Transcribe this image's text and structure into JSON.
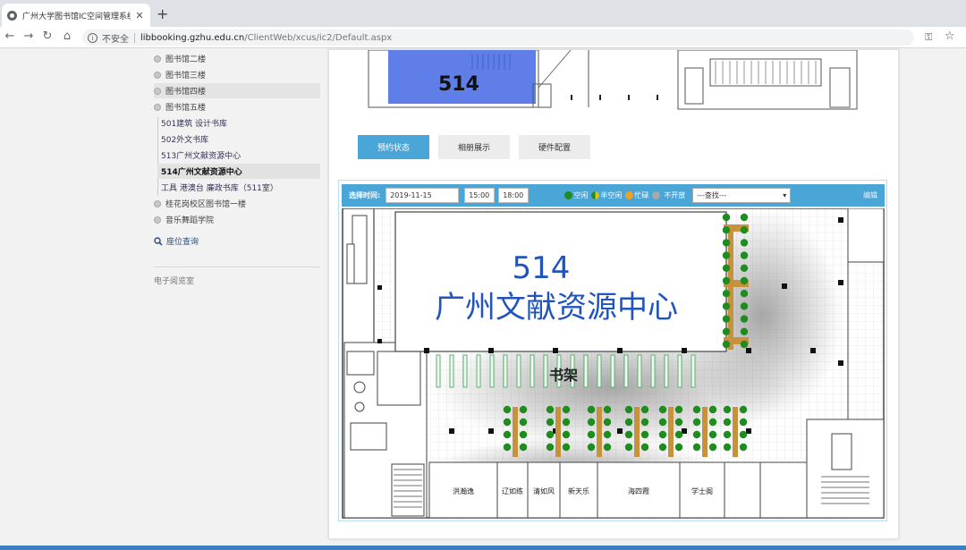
{
  "browser": {
    "tab_title": "广州大学图书馆IC空间管理系统",
    "tab_close": "✕",
    "new_tab": "+",
    "insecure_label": "不安全",
    "url_host": "libbooking.gzhu.edu.cn",
    "url_path": "/ClientWeb/xcus/ic2/Default.aspx",
    "nav": {
      "back": "←",
      "forward": "→",
      "reload": "↻",
      "home": "⌂"
    },
    "key_icon": "⚿",
    "star_icon": "☆"
  },
  "sidebar": {
    "items": [
      {
        "label": "图书馆二楼"
      },
      {
        "label": "图书馆三楼"
      },
      {
        "label": "图书馆四楼"
      },
      {
        "label": "图书馆五楼"
      }
    ],
    "sub_items": [
      {
        "label": "501建筑 设计书库"
      },
      {
        "label": "502外文书库"
      },
      {
        "label": "513广州文献资源中心"
      },
      {
        "label": "514广州文献资源中心"
      },
      {
        "label": "工具 港澳台 廉政书库（511室）"
      }
    ],
    "more_items": [
      {
        "label": "桂花岗校区图书馆一楼"
      },
      {
        "label": "音乐舞蹈学院"
      }
    ],
    "search": "座位查询",
    "ebook": "电子阅览室"
  },
  "content": {
    "top_plan_label": "514",
    "tabs": [
      {
        "label": "预约状态"
      },
      {
        "label": "相册展示"
      },
      {
        "label": "硬件配置"
      }
    ],
    "control": {
      "time_label": "选择时间:",
      "date": "2019-11-15",
      "start": "15:00",
      "end": "18:00",
      "legend": [
        {
          "label": "空闲",
          "color": "#1e8c1e"
        },
        {
          "label": "半空闲",
          "color": "#d6c21a"
        },
        {
          "label": "忙碌",
          "color": "#f0a020"
        },
        {
          "label": "不开放",
          "color": "#a8a8a8"
        }
      ],
      "find_placeholder": "---查找---",
      "edit": "编辑"
    },
    "floorplan": {
      "room_number": "514",
      "room_name": "广州文献资源中心",
      "shelf_label": "书架",
      "rooms": [
        "洪瀚逸",
        "辽如练",
        "清如风",
        "新天乐",
        "海四霞",
        "学士阁"
      ]
    }
  },
  "colors": {
    "accent": "#4ba6d8",
    "seat_free": "#1e8c1e",
    "table": "#c8913c",
    "room_text": "#2255bb"
  }
}
